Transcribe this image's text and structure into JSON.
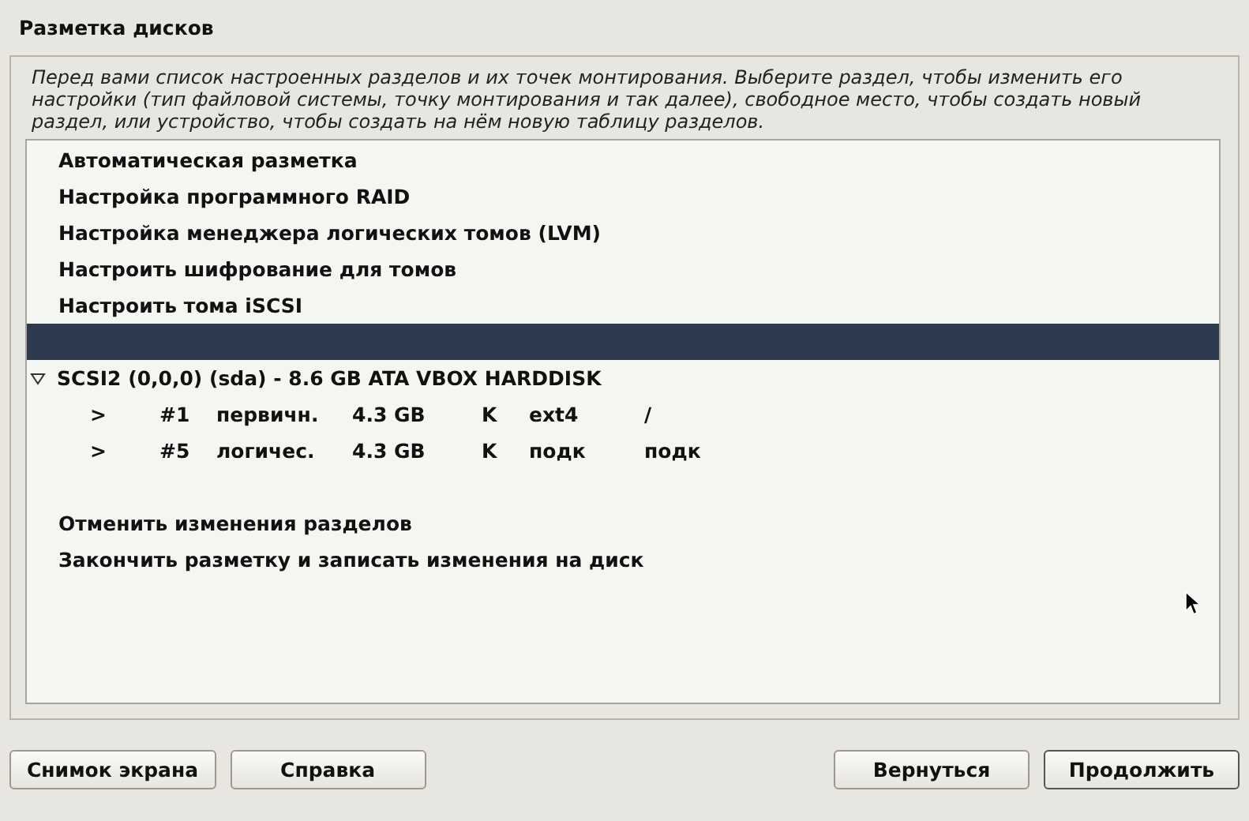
{
  "window": {
    "title": "Разметка дисков"
  },
  "description": "Перед вами список настроенных разделов и их точек монтирования. Выберите раздел, чтобы изменить его настройки (тип файловой системы, точку монтирования и так далее), свободное место, чтобы создать новый раздел, или устройство, чтобы создать на нём новую таблицу разделов.",
  "items": [
    {
      "kind": "action",
      "label": "Автоматическая разметка",
      "selected": false
    },
    {
      "kind": "action",
      "label": "Настройка программного RAID",
      "selected": false
    },
    {
      "kind": "action",
      "label": "Настройка менеджера логических томов (LVM)",
      "selected": false
    },
    {
      "kind": "action",
      "label": "Настроить шифрование для томов",
      "selected": false
    },
    {
      "kind": "action",
      "label": "Настроить тома iSCSI",
      "selected": false
    },
    {
      "kind": "blank",
      "selected": true
    },
    {
      "kind": "disk",
      "label": "SCSI2 (0,0,0) (sda) - 8.6 GB ATA VBOX HARDDISK",
      "expanded": true,
      "selected": false
    },
    {
      "kind": "partition",
      "arrow": ">",
      "number": "#1",
      "type": "первичн.",
      "size": "4.3 GB",
      "flag": "K",
      "fs": "ext4",
      "mount": "/",
      "selected": false
    },
    {
      "kind": "partition",
      "arrow": ">",
      "number": "#5",
      "type": "логичес.",
      "size": "4.3 GB",
      "flag": "K",
      "fs": "подк",
      "mount": "подк",
      "selected": false
    },
    {
      "kind": "blank",
      "selected": false
    },
    {
      "kind": "action",
      "label": "Отменить изменения разделов",
      "selected": false
    },
    {
      "kind": "action",
      "label": "Закончить разметку и записать изменения на диск",
      "selected": false
    }
  ],
  "buttons_left": [
    "Снимок экрана",
    "Справка"
  ],
  "buttons_right": [
    "Вернуться",
    "Продолжить"
  ]
}
